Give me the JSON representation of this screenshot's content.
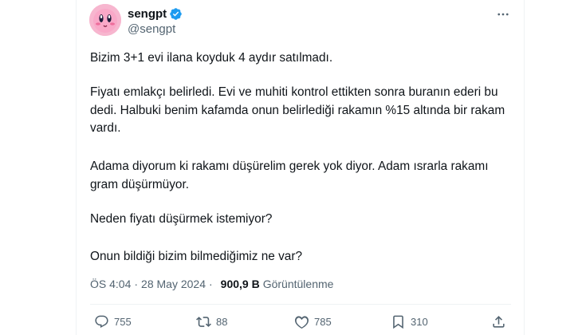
{
  "author": {
    "display_name": "sengpt",
    "handle": "@sengpt",
    "verified": true,
    "avatar_icon": "kirby-avatar"
  },
  "tweet": {
    "paragraphs": [
      "Bizim 3+1 evi ilana koyduk 4 aydır satılmadı.",
      "Fiyatı emlakçı belirledi. Evi ve muhiti kontrol ettikten sonra buranın ederi bu dedi. Halbuki benim kafamda onun belirlediği rakamın %15 altında bir rakam vardı.",
      "Adama diyorum ki rakamı düşürelim  gerek yok diyor. Adam ısrarla rakamı gram düşürmüyor.",
      "Neden fiyatı düşürmek istemiyor?",
      "Onun bildiği bizim bilmediğimiz ne var?"
    ],
    "time": "ÖS 4:04",
    "separator": "·",
    "date": "28 May 2024",
    "views_count": "900,9 B",
    "views_label": "Görüntülenme"
  },
  "actions": {
    "replies": "755",
    "retweets": "88",
    "likes": "785",
    "views": "310"
  },
  "colors": {
    "text": "#0f1419",
    "secondary": "#536471",
    "verified": "#1d9bf0",
    "border": "#eff3f4"
  }
}
